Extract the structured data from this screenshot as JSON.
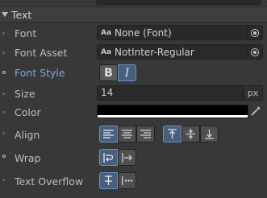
{
  "section": {
    "title": "Text"
  },
  "rows": {
    "font": {
      "label": "Font",
      "value": "None (Font)",
      "prefix": "Aa"
    },
    "font_asset": {
      "label": "Font Asset",
      "value": "NotInter-Regular",
      "prefix": "Aa"
    },
    "font_style": {
      "label": "Font Style",
      "bold": "B",
      "italic": "I",
      "italic_active": true
    },
    "size": {
      "label": "Size",
      "value": "14",
      "unit": "px"
    },
    "color": {
      "label": "Color",
      "value": "#000000"
    },
    "align": {
      "label": "Align",
      "horizontal": [
        "align-left-icon",
        "align-center-icon",
        "align-right-icon"
      ],
      "vertical": [
        "align-top-icon",
        "align-middle-icon",
        "align-bottom-icon"
      ]
    },
    "wrap": {
      "label": "Wrap",
      "options": [
        "wrap-icon",
        "overflow-icon"
      ]
    },
    "text_overflow": {
      "label": "Text Overflow",
      "options": [
        "clip-icon",
        "ellipsis-icon"
      ]
    }
  },
  "colors": {
    "accent": "#46607e",
    "accent_border": "#6e93c4",
    "active_label": "#7ea6e0"
  }
}
